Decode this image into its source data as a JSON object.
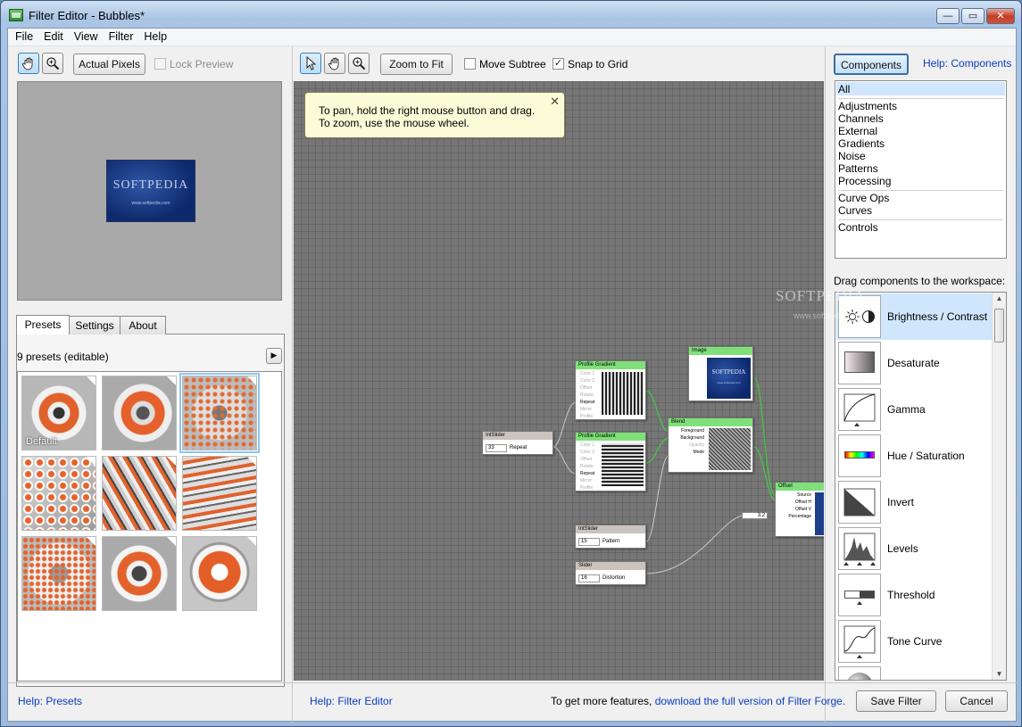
{
  "window": {
    "title": "Filter Editor - Bubbles*",
    "min_label": "—",
    "max_label": "▭",
    "close_label": "✕"
  },
  "menu": [
    "File",
    "Edit",
    "View",
    "Filter",
    "Help"
  ],
  "left_toolbar": {
    "actual_pixels": "Actual Pixels",
    "lock_preview": "Lock Preview",
    "lock_checked": false
  },
  "preview": {
    "logo_text": "SOFTPEDIA",
    "logo_sub": "www.softpedia.com"
  },
  "tabs": [
    "Presets",
    "Settings",
    "About"
  ],
  "presets": {
    "count_label": "9 presets (editable)",
    "play_label": "▶",
    "default_label": "Default",
    "help": "Help: Presets"
  },
  "center_toolbar": {
    "zoom_fit": "Zoom to Fit",
    "move_subtree": "Move Subtree",
    "move_checked": false,
    "snap_grid": "Snap to Grid",
    "snap_checked": true,
    "check_mark": "✓"
  },
  "tooltip": {
    "line1": "To pan, hold the right mouse button and drag.",
    "line2": "To zoom, use the mouse wheel.",
    "close": "✕"
  },
  "nodes": {
    "profile1": {
      "title": "Profile Gradient",
      "ports": [
        "Color 1",
        "Color 2",
        "Offset",
        "Rotate",
        "Repeat",
        "Mirror",
        "Profile"
      ]
    },
    "profile2": {
      "title": "Profile Gradient",
      "ports": [
        "Color 1",
        "Color 2",
        "Offset",
        "Rotate",
        "Repeat",
        "Mirror",
        "Profile"
      ]
    },
    "image": {
      "title": "Image",
      "logo": "SOFTPEDIA",
      "sub": "www.softpedia.com"
    },
    "blend": {
      "title": "Blend",
      "ports": [
        "Foreground",
        "Background",
        "Opacity",
        "Mode"
      ]
    },
    "offset": {
      "title": "Offset",
      "ports": [
        "Source",
        "Offset H",
        "Offset V",
        "Percentage"
      ],
      "value": "3.2"
    },
    "intslider1": {
      "title": "IntSlider",
      "value": "33",
      "label": "Repeat"
    },
    "intslider2": {
      "title": "IntSlider",
      "value": "15",
      "label": "Pattern"
    },
    "slider": {
      "title": "Slider",
      "value": "16",
      "label": "Distortion"
    }
  },
  "center_bottom": {
    "help": "Help: Filter Editor",
    "promo_prefix": "To get more features,",
    "promo_link": "download the full version of Filter Forge."
  },
  "right_panel": {
    "components_btn": "Components",
    "help": "Help: Components",
    "categories": [
      "All",
      "Adjustments",
      "Channels",
      "External",
      "Gradients",
      "Noise",
      "Patterns",
      "Processing",
      "Curve Ops",
      "Curves",
      "Controls"
    ],
    "drag_label": "Drag components to the workspace:",
    "components": [
      "Brightness / Contrast",
      "Desaturate",
      "Gamma",
      "Hue / Saturation",
      "Invert",
      "Levels",
      "Threshold",
      "Tone Curve"
    ]
  },
  "buttons": {
    "save": "Save Filter",
    "cancel": "Cancel"
  },
  "watermark": {
    "line1": "SOFTPEDIA",
    "line2": "www.softpedia.com"
  }
}
